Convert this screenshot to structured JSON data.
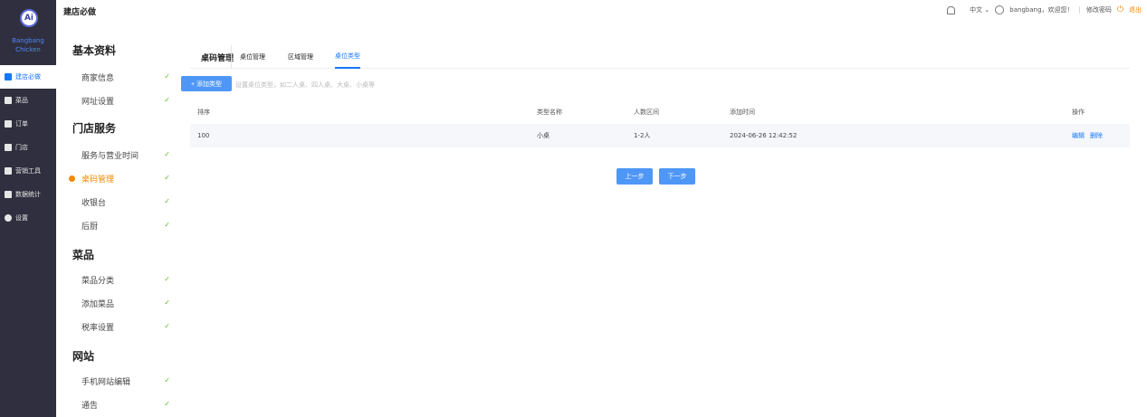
{
  "leftnav": {
    "logo_text": "Ai",
    "brand_line1": "Bangbang",
    "brand_line2": "Chicken",
    "items": [
      {
        "label": "建店必做",
        "icon": "edit-icon"
      },
      {
        "label": "菜品",
        "icon": "dish-icon"
      },
      {
        "label": "订单",
        "icon": "utensils-icon"
      },
      {
        "label": "门店",
        "icon": "store-icon"
      },
      {
        "label": "营销工具",
        "icon": "thumb-up-icon"
      },
      {
        "label": "数据统计",
        "icon": "chart-icon"
      },
      {
        "label": "设置",
        "icon": "gear-icon"
      }
    ]
  },
  "topbar": {
    "title": "建店必做",
    "language": "中文",
    "user_text": "bangbang，欢迎您！",
    "separator": "|",
    "change_password": "修改密码",
    "logout": "退出"
  },
  "setup_menu": {
    "sections": [
      {
        "title": "基本资料"
      },
      {
        "title": "门店服务"
      },
      {
        "title": "菜品"
      },
      {
        "title": "网站"
      }
    ],
    "items": [
      {
        "label": "商家信息",
        "done": "✓"
      },
      {
        "label": "网址设置",
        "done": "✓"
      },
      {
        "label": "服务与营业时间",
        "done": "✓"
      },
      {
        "label": "桌码管理",
        "done": "✓"
      },
      {
        "label": "收银台",
        "done": "✓"
      },
      {
        "label": "后厨",
        "done": "✓"
      },
      {
        "label": "菜品分类",
        "done": "✓"
      },
      {
        "label": "添加菜品",
        "done": "✓"
      },
      {
        "label": "税率设置",
        "done": "✓"
      },
      {
        "label": "手机网站编辑",
        "done": "✓"
      },
      {
        "label": "通告",
        "done": "✓"
      }
    ]
  },
  "main": {
    "tabs": [
      {
        "label": "桌码管理"
      },
      {
        "label": "桌位管理"
      },
      {
        "label": "区域管理"
      },
      {
        "label": "桌位类型"
      }
    ],
    "add_button": "+ 添加类型",
    "hint": "设置桌位类型，如二人桌、四人桌、大桌、小桌等",
    "table": {
      "headers": [
        "排序",
        "类型名称",
        "人数区间",
        "添加时间",
        "操作"
      ],
      "rows": [
        {
          "order": "100",
          "name": "小桌",
          "range": "1-2人",
          "time": "2024-06-26 12:42:52",
          "edit": "编辑",
          "delete": "删除"
        }
      ]
    },
    "prev_button": "上一步",
    "next_button": "下一步"
  },
  "colors": {
    "nav_bg": "#2f2f3f",
    "primary": "#4f97f7",
    "link": "#1677ff",
    "active_orange": "#f08a00",
    "check_green": "#52c41a"
  }
}
